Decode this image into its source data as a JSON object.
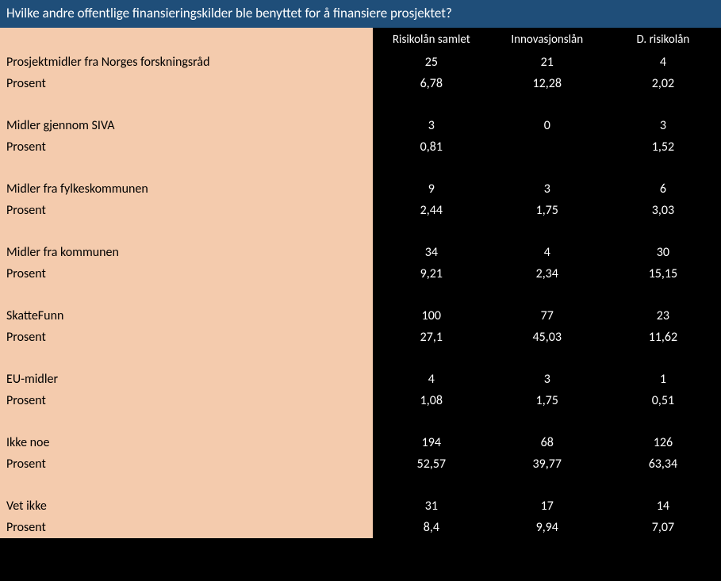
{
  "title": "Hvilke andre offentlige finansieringskilder ble benyttet for å finansiere prosjektet?",
  "headers": {
    "c1": "Risikolån samlet",
    "c2": "Innovasjonslån",
    "c3": "D. risikolån"
  },
  "chart_data": {
    "type": "table",
    "title": "Hvilke andre offentlige finansieringskilder ble benyttet for å finansiere prosjektet?",
    "columns": [
      "Risikolån samlet",
      "Innovasjonslån",
      "D. risikolån"
    ],
    "series": [
      {
        "name": "Prosjektmidler fra Norges forskningsråd",
        "values": [
          25,
          21,
          4
        ],
        "percent": [
          "6,78",
          "12,28",
          "2,02"
        ]
      },
      {
        "name": "Midler gjennom SIVA",
        "values": [
          3,
          0,
          3
        ],
        "percent": [
          "0,81",
          "",
          "1,52"
        ]
      },
      {
        "name": "Midler fra fylkeskommunen",
        "values": [
          9,
          3,
          6
        ],
        "percent": [
          "2,44",
          "1,75",
          "3,03"
        ]
      },
      {
        "name": "Midler fra kommunen",
        "values": [
          34,
          4,
          30
        ],
        "percent": [
          "9,21",
          "2,34",
          "15,15"
        ]
      },
      {
        "name": "SkatteFunn",
        "values": [
          100,
          77,
          23
        ],
        "percent": [
          "27,1",
          "45,03",
          "11,62"
        ]
      },
      {
        "name": "EU-midler",
        "values": [
          4,
          3,
          1
        ],
        "percent": [
          "1,08",
          "1,75",
          "0,51"
        ]
      },
      {
        "name": "Ikke noe",
        "values": [
          194,
          68,
          126
        ],
        "percent": [
          "52,57",
          "39,77",
          "63,34"
        ]
      },
      {
        "name": "Vet ikke",
        "values": [
          31,
          17,
          14
        ],
        "percent": [
          "8,4",
          "9,94",
          "7,07"
        ]
      }
    ]
  },
  "percent_label": "Prosent",
  "rows": {
    "r0": {
      "label": "Prosjektmidler fra Norges forskningsråd",
      "c1": "25",
      "c2": "21",
      "c3": "4",
      "p1": "6,78",
      "p2": "12,28",
      "p3": "2,02"
    },
    "r1": {
      "label": "Midler gjennom SIVA",
      "c1": "3",
      "c2": "0",
      "c3": "3",
      "p1": "0,81",
      "p2": "",
      "p3": "1,52"
    },
    "r2": {
      "label": "Midler fra fylkeskommunen",
      "c1": "9",
      "c2": "3",
      "c3": "6",
      "p1": "2,44",
      "p2": "1,75",
      "p3": "3,03"
    },
    "r3": {
      "label": "Midler fra kommunen",
      "c1": "34",
      "c2": "4",
      "c3": "30",
      "p1": "9,21",
      "p2": "2,34",
      "p3": "15,15"
    },
    "r4": {
      "label": "SkatteFunn",
      "c1": "100",
      "c2": "77",
      "c3": "23",
      "p1": "27,1",
      "p2": "45,03",
      "p3": "11,62"
    },
    "r5": {
      "label": "EU-midler",
      "c1": "4",
      "c2": "3",
      "c3": "1",
      "p1": "1,08",
      "p2": "1,75",
      "p3": "0,51"
    },
    "r6": {
      "label": "Ikke noe",
      "c1": "194",
      "c2": "68",
      "c3": "126",
      "p1": "52,57",
      "p2": "39,77",
      "p3": "63,34"
    },
    "r7": {
      "label": "Vet ikke",
      "c1": "31",
      "c2": "17",
      "c3": "14",
      "p1": "8,4",
      "p2": "9,94",
      "p3": "7,07"
    }
  }
}
